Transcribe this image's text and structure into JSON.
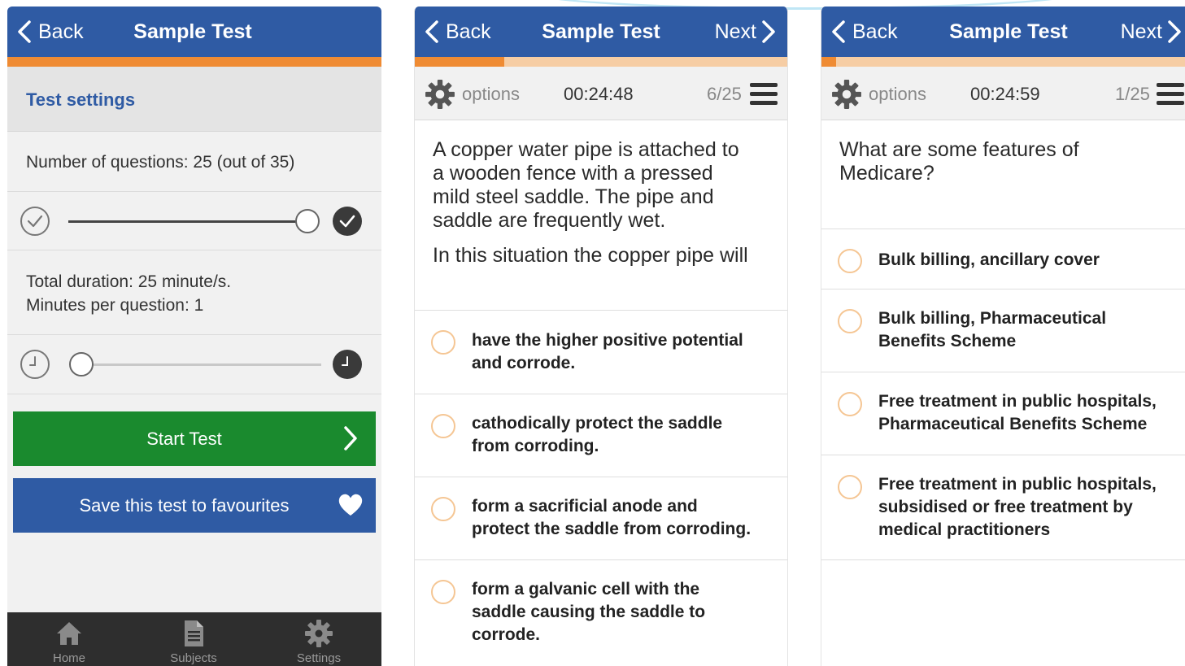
{
  "colors": {
    "nav_blue": "#2f5ba4",
    "accent_orange": "#ef8b33",
    "progress_track": "#f6cda4",
    "start_green": "#1a8a2e",
    "tabbar": "#2e2e2e"
  },
  "screens": [
    {
      "nav": {
        "back_label": "Back",
        "title": "Sample Test"
      },
      "progress": 1.0,
      "section_title": "Test settings",
      "questions_label": "Number of questions: 25 (out of 35)",
      "questions_slider": {
        "value": 25,
        "max": 35
      },
      "duration_line1": "Total duration: 25 minute/s.",
      "duration_line2": "Minutes per question: 1",
      "duration_slider": {
        "value": 1
      },
      "start_button": "Start Test",
      "save_button": "Save this test to favourites",
      "tabs": [
        {
          "label": "Home",
          "icon": "home-icon"
        },
        {
          "label": "Subjects",
          "icon": "document-icon"
        },
        {
          "label": "Settings",
          "icon": "gear-icon"
        }
      ]
    },
    {
      "nav": {
        "back_label": "Back",
        "title": "Sample Test",
        "next_label": "Next"
      },
      "progress": 0.24,
      "options_label": "options",
      "timer": "00:24:48",
      "counter": "6/25",
      "question_lines": [
        "A copper water pipe is attached to",
        "a wooden fence with a pressed",
        "mild steel saddle. The pipe and",
        "saddle are frequently wet."
      ],
      "question_prompt": "In this situation the copper pipe will",
      "answers": [
        [
          "have the higher positive potential",
          "and corrode."
        ],
        [
          "cathodically protect the saddle",
          "from corroding."
        ],
        [
          "form a sacrificial anode and",
          "protect the saddle from corroding."
        ],
        [
          "form a galvanic cell with the",
          "saddle causing the saddle to",
          "corrode."
        ]
      ]
    },
    {
      "nav": {
        "back_label": "Back",
        "title": "Sample Test",
        "next_label": "Next"
      },
      "progress": 0.04,
      "options_label": "options",
      "timer": "00:24:59",
      "counter": "1/25",
      "question_lines": [
        "What are some features of",
        "Medicare?"
      ],
      "answers": [
        [
          "Bulk billing, ancillary cover"
        ],
        [
          "Bulk billing, Pharmaceutical",
          "Benefits Scheme"
        ],
        [
          "Free treatment in public hospitals,",
          "Pharmaceutical Benefits Scheme"
        ],
        [
          "Free treatment in public hospitals,",
          "subsidised or free treatment by",
          "medical practitioners"
        ]
      ]
    }
  ]
}
